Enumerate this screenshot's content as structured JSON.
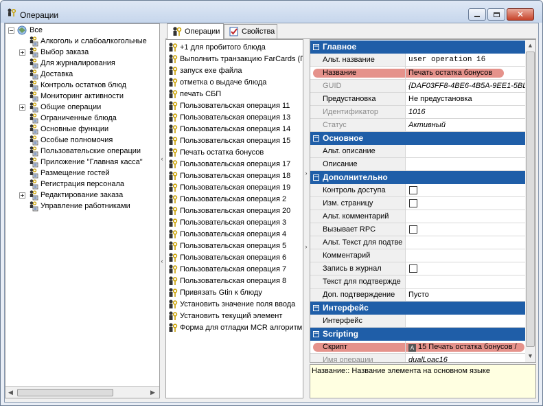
{
  "window": {
    "title": "Операции",
    "icon": "operations-icon"
  },
  "tree": {
    "root": "Все",
    "items": [
      {
        "label": "Алкоголь и слабоалкогольные",
        "expandable": false
      },
      {
        "label": "Выбор заказа",
        "expandable": true
      },
      {
        "label": "Для журналирования",
        "expandable": false
      },
      {
        "label": "Доставка",
        "expandable": false
      },
      {
        "label": "Контроль остатков блюд",
        "expandable": false
      },
      {
        "label": "Мониторинг активности",
        "expandable": false
      },
      {
        "label": "Общие операции",
        "expandable": true
      },
      {
        "label": "Ограниченные блюда",
        "expandable": false
      },
      {
        "label": "Основные функции",
        "expandable": false
      },
      {
        "label": "Особые полномочия",
        "expandable": false
      },
      {
        "label": "Пользовательские операции",
        "expandable": false
      },
      {
        "label": "Приложение \"Главная касса\"",
        "expandable": false
      },
      {
        "label": "Размещение гостей",
        "expandable": false
      },
      {
        "label": "Регистрация персонала",
        "expandable": false
      },
      {
        "label": "Редактирование заказа",
        "expandable": true
      },
      {
        "label": "Управление работниками",
        "expandable": false
      }
    ]
  },
  "tabs": [
    {
      "label": "Операции",
      "active": true,
      "icon": "key-user-icon"
    },
    {
      "label": "Свойства",
      "active": false,
      "icon": "checklist-icon"
    }
  ],
  "operations": [
    "+1 для пробитого блюда",
    "Выполнить транзакцию FarCards (П,",
    "запуск exe файла",
    "отметка о выдаче блюда",
    "печать СБП",
    "Пользовательская операция 11",
    "Пользовательская операция 13",
    "Пользовательская операция 14",
    "Пользовательская операция 15",
    "Печать остатка бонусов",
    "Пользовательская операция 17",
    "Пользовательская операция 18",
    "Пользовательская операция 19",
    "Пользовательская операция 2",
    "Пользовательская операция 20",
    "Пользовательская операция 3",
    "Пользовательская операция 4",
    "Пользовательская операция 5",
    "Пользовательская операция 6",
    "Пользовательская операция 7",
    "Пользовательская операция 8",
    "Привязать Gtin к блюду",
    "Установить значение поля ввода",
    "Установить текущий элемент",
    "Форма для отладки MCR алгоритм"
  ],
  "properties": {
    "rows": [
      {
        "type": "cat",
        "name": "Главное"
      },
      {
        "type": "prop",
        "name": "Альт. название",
        "value": "user operation 16",
        "style": "mono"
      },
      {
        "type": "prop",
        "name": "Название",
        "value": "Печать остатка бонусов",
        "highlight": true
      },
      {
        "type": "prop",
        "name": "GUID",
        "value": "{DAF03FF8-4BE6-4B5A-9EE1-5BL",
        "style": "it",
        "disabled": true
      },
      {
        "type": "prop",
        "name": "Предустановка",
        "value": "Не предустановка"
      },
      {
        "type": "prop",
        "name": "Идентификатор",
        "value": "1016",
        "style": "it",
        "disabled": true
      },
      {
        "type": "prop",
        "name": "Статус",
        "value": "Активный",
        "style": "it",
        "disabled": true
      },
      {
        "type": "cat",
        "name": "Основное"
      },
      {
        "type": "prop",
        "name": "Альт. описание",
        "value": ""
      },
      {
        "type": "prop",
        "name": "Описание",
        "value": ""
      },
      {
        "type": "cat",
        "name": "Дополнительно"
      },
      {
        "type": "prop",
        "name": "Контроль доступа",
        "checkbox": true
      },
      {
        "type": "prop",
        "name": "Изм. страницу",
        "checkbox": true
      },
      {
        "type": "prop",
        "name": "Альт. комментарий",
        "value": ""
      },
      {
        "type": "prop",
        "name": "Вызывает RPC",
        "checkbox": true
      },
      {
        "type": "prop",
        "name": "Альт. Текст для подтве",
        "value": ""
      },
      {
        "type": "prop",
        "name": "Комментарий",
        "value": ""
      },
      {
        "type": "prop",
        "name": "Запись в журнал",
        "checkbox": true
      },
      {
        "type": "prop",
        "name": "Текст для подтвержде",
        "value": ""
      },
      {
        "type": "prop",
        "name": "Доп. подтверждение",
        "value": "Пусто"
      },
      {
        "type": "cat",
        "name": "Интерфейс"
      },
      {
        "type": "prop",
        "name": "Интерфейс",
        "value": ""
      },
      {
        "type": "cat",
        "name": "Scripting"
      },
      {
        "type": "prop",
        "name": "Скрипт",
        "value": "15 Печать остатка бонусов /",
        "highlight": true,
        "valueIcon": true
      },
      {
        "type": "prop",
        "name": "Имя операции",
        "value": "dualLoac16",
        "disabled": true,
        "style": "it"
      }
    ]
  },
  "description": "Название:: Название элемента на основном языке",
  "colors": {
    "category": "#1f5ea8",
    "highlight": "#dc6e64",
    "descBg": "#ffffe1"
  }
}
